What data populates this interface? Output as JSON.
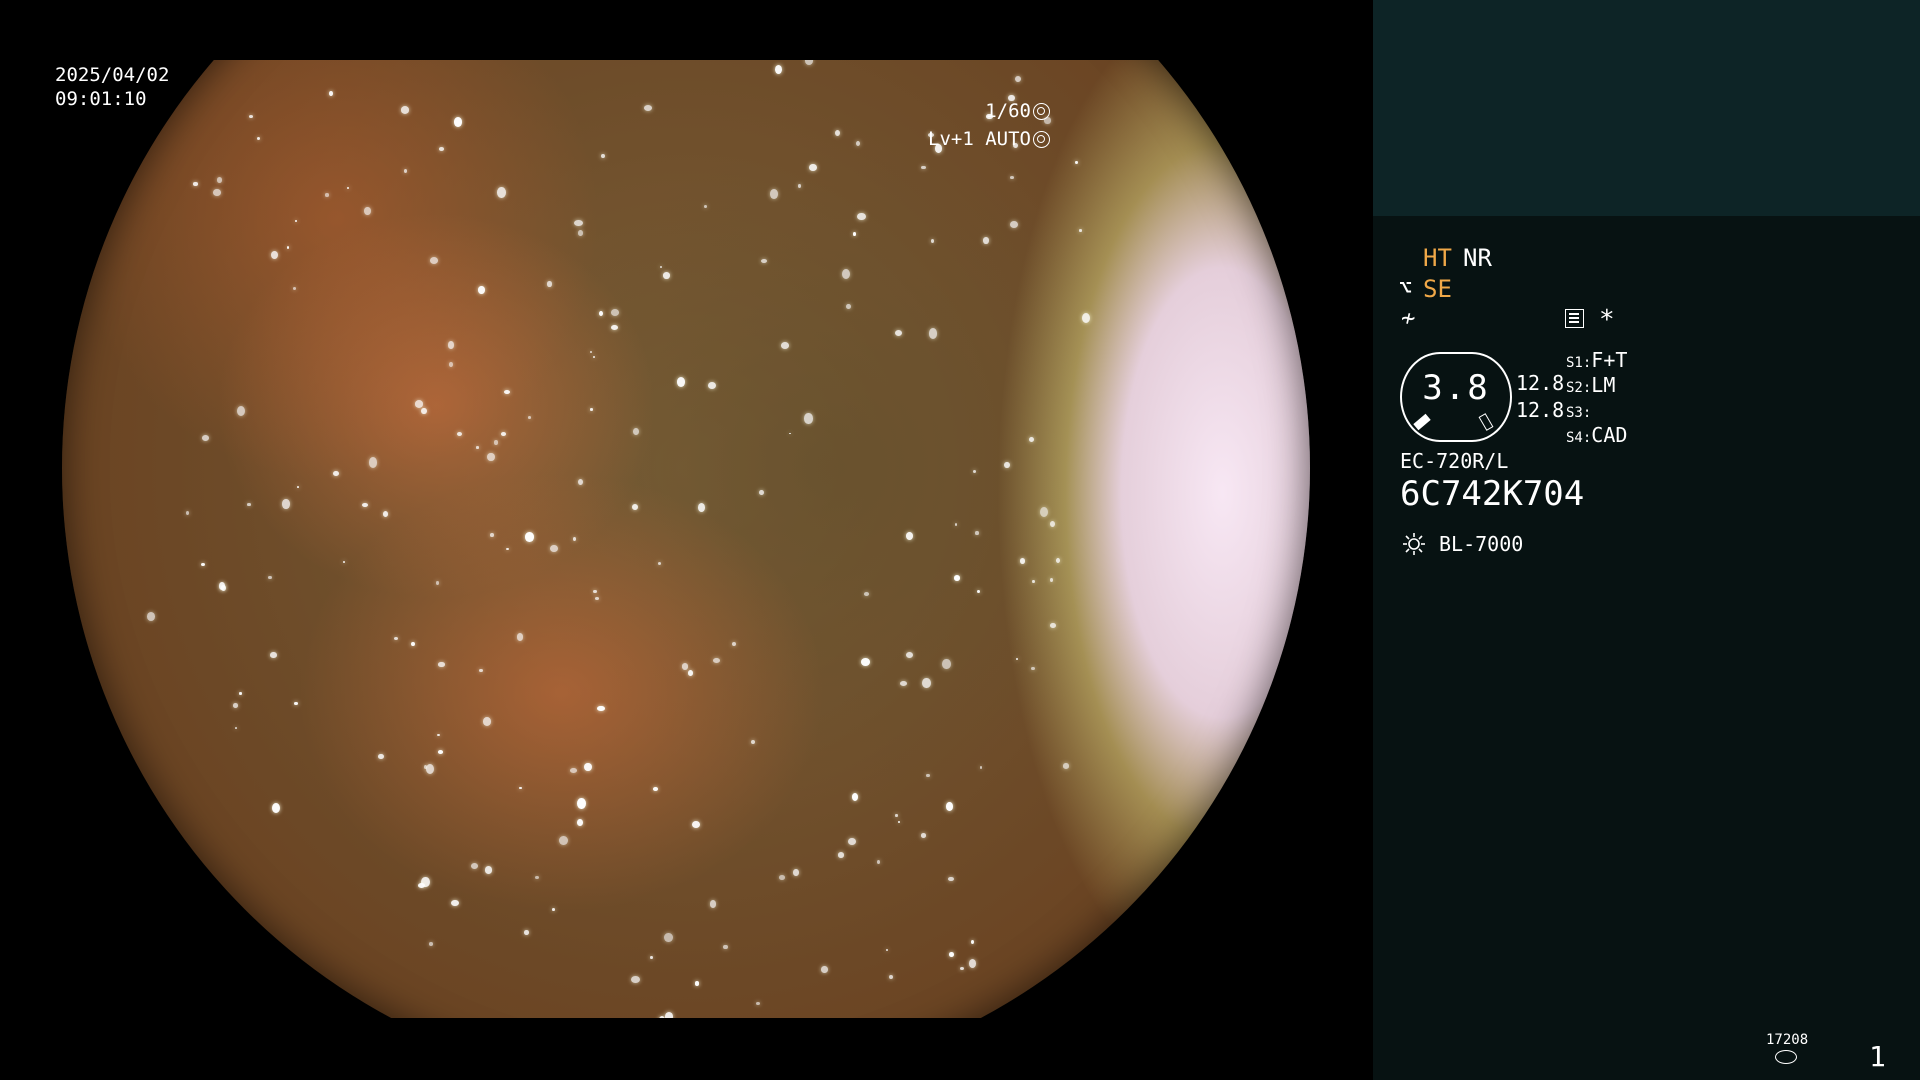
{
  "viewport": {
    "date": "2025/04/02",
    "time": "09:01:10",
    "shutter": "1/60",
    "shutter_icon": "shutter-icon",
    "level": "Lv+1",
    "exposure_mode": "AUTO",
    "exposure_icon": "iris-icon"
  },
  "panel": {
    "ht": "HT",
    "nr": "NR",
    "se": "SE",
    "se_icon": "structure-enhance-icon",
    "slash_icon": "color-enhance-icon",
    "menu_icon": "menu-icon",
    "asterisk": "*",
    "gauge_value": "3.8",
    "value_a": "12.8",
    "value_b": "12.8",
    "s1_label": "S1:",
    "s1_value": "F+T",
    "s2_label": "S2:",
    "s2_value": "LM",
    "s3_label": "S3:",
    "s3_value": "",
    "s4_label": "S4:",
    "s4_value": "CAD",
    "model": "EC-720R/L",
    "serial": "6C742K704",
    "light_icon": "light-source-icon",
    "light_source": "BL-7000",
    "counter": "17208",
    "disk_icon": "disk-icon",
    "page_number": "1"
  },
  "colors": {
    "panel_bg": "#071212",
    "panel_top_bg": "#0d2426",
    "accent_orange": "#f0a848"
  }
}
